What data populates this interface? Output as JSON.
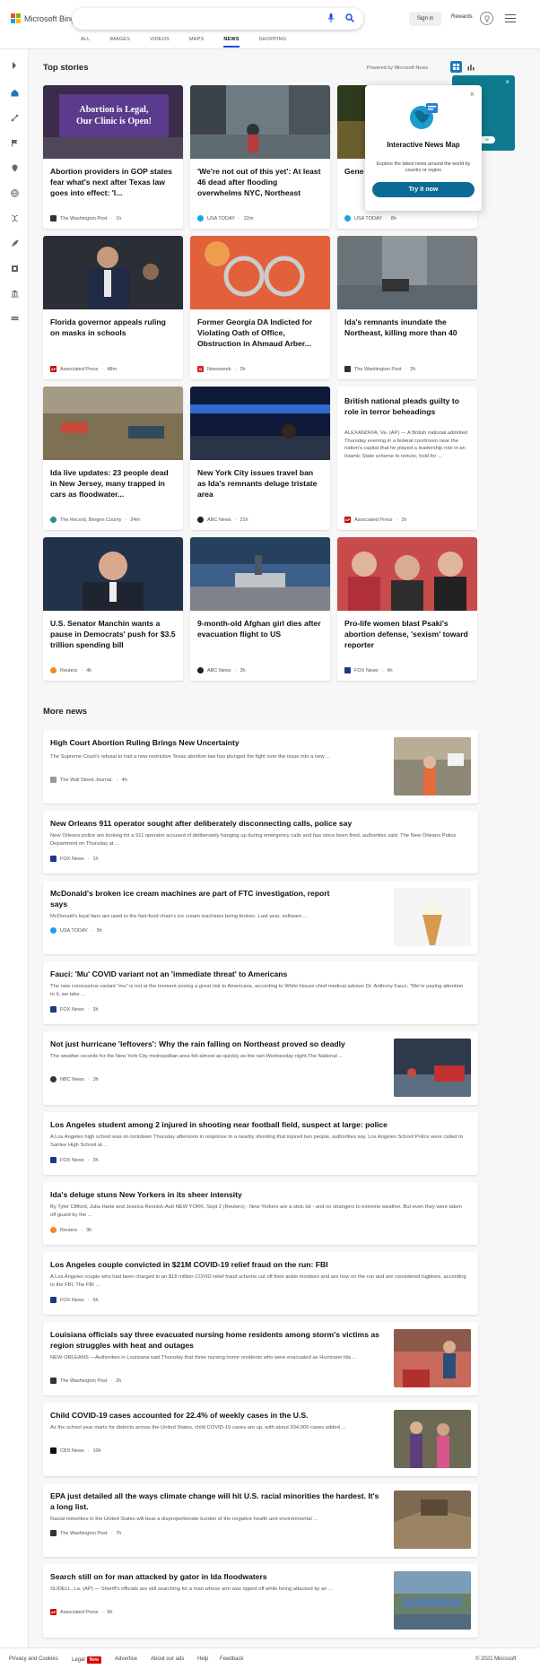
{
  "header": {
    "brand": "Microsoft Bing",
    "search_value": "",
    "signin_label": "Sign in",
    "rewards_label": "Rewards",
    "tabs": [
      {
        "label": "ALL"
      },
      {
        "label": "IMAGES"
      },
      {
        "label": "VIDEOS"
      },
      {
        "label": "MAPS"
      },
      {
        "label": "NEWS"
      },
      {
        "label": "SHOPPING"
      }
    ],
    "active_tab": "NEWS"
  },
  "leftrail": {
    "icons": [
      "chevron-right-icon",
      "home-icon",
      "science-icon",
      "flag-icon",
      "map-pin-icon",
      "globe-icon",
      "dna-icon",
      "rocket-icon",
      "film-icon",
      "bank-icon",
      "stack-icon"
    ]
  },
  "top_stories": {
    "title": "Top stories",
    "powered_by": "Powered by Microsoft News",
    "cards": [
      {
        "title": "Abortion providers in GOP states fear what's next after Texas law goes into effect: 'I...",
        "source": "The Washington Post",
        "time": "1h",
        "image_text": "Abortion is Legal, Our Clinic is Open!"
      },
      {
        "title": "'We're not out of this yet': At least 46 dead after flooding overwhelms NYC, Northeast",
        "source": "USA TODAY",
        "time": "22m"
      },
      {
        "title": "Gene halt p plant",
        "source": "USA TODAY",
        "time": "8h"
      },
      {
        "title": "Florida governor appeals ruling on masks in schools",
        "source": "Associated Press",
        "time": "48m"
      },
      {
        "title": "Former Georgia DA Indicted for Violating Oath of Office, Obstruction in Ahmaud Arber...",
        "source": "Newsweek",
        "time": "2h"
      },
      {
        "title": "Ida's remnants inundate the Northeast, killing more than 40",
        "source": "The Washington Post",
        "time": "2h"
      },
      {
        "title": "Ida live updates: 23 people dead in New Jersey, many trapped in cars as floodwater...",
        "source": "The Record, Bergen County",
        "time": "24m"
      },
      {
        "title": "New York City issues travel ban as Ida's remnants deluge tristate area",
        "source": "ABC News",
        "time": "21h"
      },
      {
        "title": "British national pleads guilty to role in terror beheadings",
        "body": "ALEXANDRIA, Va. (AP) — A British national admitted Thursday evening in a federal courtroom near the nation's capital that he played a leadership role in an Islamic State scheme to torture, hold for ...",
        "source": "Associated Press",
        "time": "2h"
      },
      {
        "title": "U.S. Senator Manchin wants a pause in Democrats' push for $3.5 trillion spending bill",
        "source": "Reuters",
        "time": "4h"
      },
      {
        "title": "9-month-old Afghan girl dies after evacuation flight to US",
        "source": "ABC News",
        "time": "3h"
      },
      {
        "title": "Pro-life women blast Psaki's abortion defense, 'sexism' toward reporter",
        "source": "FOX News",
        "time": "4h"
      }
    ]
  },
  "popup": {
    "title": "Interactive News Map",
    "description": "Explore the latest news around the world by country or region",
    "button_label": "Try it now",
    "partial_label": "w"
  },
  "more_news": {
    "title": "More news",
    "items": [
      {
        "title": "High Court Abortion Ruling Brings New Uncertainty",
        "body": "The Supreme Court's refusal to halt a new restrictive Texas abortion law has plunged the fight over the issue into a new ...",
        "source": "The Wall Street Journal.",
        "time": "4h"
      },
      {
        "title": "New Orleans 911 operator sought after deliberately disconnecting calls, police say",
        "body": "New Orleans police are looking for a 911 operator accused of deliberately hanging up during emergency calls and has since been fired, authorities said. The New Orleans Police Department on Thursday at ...",
        "source": "FOX News",
        "time": "1h"
      },
      {
        "title": "McDonald's broken ice cream machines are part of FTC investigation, report says",
        "body": "McDonald's loyal fans are used to the fast-food chain's ice cream machines being broken. Last year, software ...",
        "source": "USA TODAY",
        "time": "5h"
      },
      {
        "title": "Fauci: 'Mu' COVID variant not an 'immediate threat' to Americans",
        "body": "The new coronavirus variant \"mu\" is not at the moment posing a great risk to Americans, according to White House chief medical advisor Dr. Anthony Fauci. \"We're paying attention to it, we take ...",
        "source": "FOX News",
        "time": "3h"
      },
      {
        "title": "Not just hurricane 'leftovers': Why the rain falling on Northeast proved so deadly",
        "body": "The weather records for the New York City metropolitan area fell almost as quickly as the rain Wednesday night.The National ...",
        "source": "NBC News",
        "time": "3h"
      },
      {
        "title": "Los Angeles student among 2 injured in shooting near football field, suspect at large: police",
        "body": "A Los Angeles high school was on lockdown Thursday afternoon in response to a nearby shooting that injured two people, authorities say. Los Angeles School Police were called to Santee High School at ...",
        "source": "FOX News",
        "time": "3h"
      },
      {
        "title": "Ida's deluge stuns New Yorkers in its sheer intensity",
        "body": "By Tyler Clifford, Julia Harte and Jessica Resnick-Ault NEW YORK, Sept 2 (Reuters) - New Yorkers are a stoic lot - and no strangers to extreme weather. But even they were taken off guard by the ...",
        "source": "Reuters",
        "time": "3h"
      },
      {
        "title": "Los Angeles couple convicted in $21M COVID-19 relief fraud on the run: FBI",
        "body": "A Los Angeles couple who had been charged in an $18 million COVID relief fraud scheme cut off their ankle monitors and are now on the run and are considered fugitives, according to the FBI.  The FBI ...",
        "source": "FOX News",
        "time": "5h"
      },
      {
        "title": "Louisiana officials say three evacuated nursing home residents among storm's victims as region struggles with heat and outages",
        "body": "NEW ORLEANS —Authorities in Louisiana said Thursday that three nursing home residents who were evacuated as Hurricane Ida ...",
        "source": "The Washington Post",
        "time": "2h"
      },
      {
        "title": "Child COVID-19 cases accounted for 22.4% of weekly cases in the U.S.",
        "body": "As the school year starts for districts across the United States, child COVID-19 cases are up, with about 204,000 cases added ...",
        "source": "CBS News",
        "time": "10h"
      },
      {
        "title": "EPA just detailed all the ways climate change will hit U.S. racial minorities the hardest. It's a long list.",
        "body": "Racial minorities in the United States will bear a disproportionate burden of the negative health and environmental ...",
        "source": "The Washington Post",
        "time": "7h"
      },
      {
        "title": "Search still on for man attacked by gator in Ida floodwaters",
        "body": "SLIDELL, La. (AP) — Sheriff's officials are still searching for a man whose arm was ripped off while being attacked by an ...",
        "source": "Associated Press",
        "time": "9h"
      }
    ]
  },
  "footer": {
    "links": [
      "Privacy and Cookies",
      "Legal",
      "Advertise",
      "About our ads",
      "Help",
      "Feedback"
    ],
    "new_badge": "New",
    "copyright": "© 2021 Microsoft"
  },
  "colors": {
    "accent": "#174ae4",
    "teal": "#0d7b8d",
    "button": "#0c6b96"
  }
}
